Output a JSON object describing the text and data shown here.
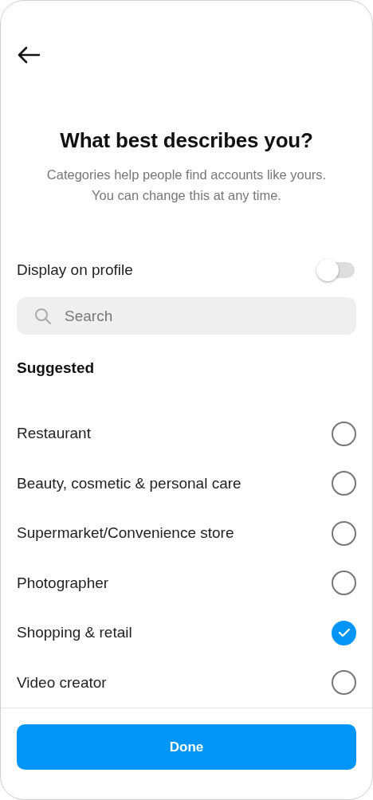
{
  "header": {
    "title": "What best describes you?",
    "subtitle": "Categories help people find accounts like yours. You can change this at any time."
  },
  "display_on_profile": {
    "label": "Display on profile",
    "on": false
  },
  "search": {
    "placeholder": "Search"
  },
  "section_title": "Suggested",
  "categories": [
    {
      "label": "Restaurant",
      "selected": false
    },
    {
      "label": "Beauty, cosmetic & personal care",
      "selected": false
    },
    {
      "label": "Supermarket/Convenience store",
      "selected": false
    },
    {
      "label": "Photographer",
      "selected": false
    },
    {
      "label": "Shopping & retail",
      "selected": true
    },
    {
      "label": "Video creator",
      "selected": false
    }
  ],
  "done_button": "Done"
}
